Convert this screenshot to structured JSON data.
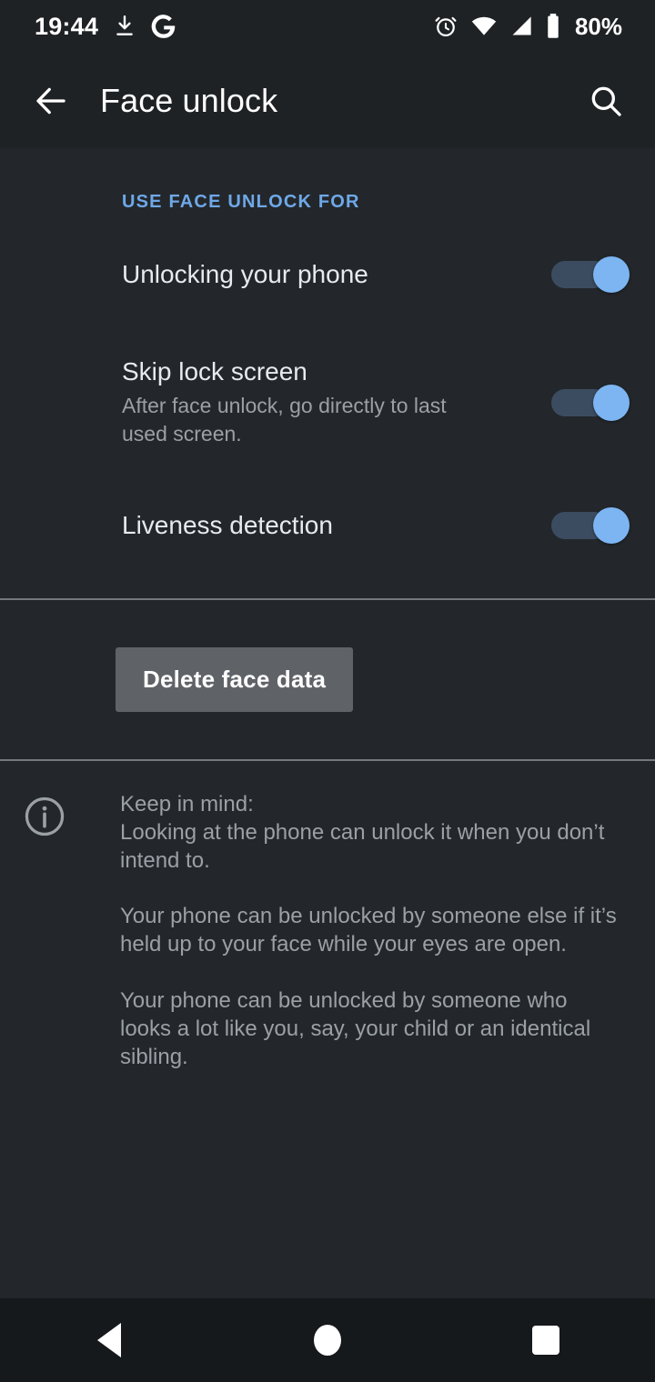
{
  "status_bar": {
    "clock": "19:44",
    "battery_percent": "80%",
    "icons_left": [
      "download-icon",
      "google-g-icon"
    ],
    "icons_right": [
      "alarm-icon",
      "wifi-icon",
      "cellular-signal-icon",
      "battery-icon"
    ]
  },
  "app_bar": {
    "back_icon": "back-arrow-icon",
    "title": "Face unlock",
    "search_icon": "search-icon"
  },
  "content": {
    "section_header": "USE FACE UNLOCK FOR",
    "preferences": [
      {
        "title": "Unlocking your phone",
        "subtitle": "",
        "switch_on": true
      },
      {
        "title": "Skip lock screen",
        "subtitle": "After face unlock, go directly to last used screen.",
        "switch_on": true
      },
      {
        "title": "Liveness detection",
        "subtitle": "",
        "switch_on": true
      }
    ],
    "delete_button": "Delete face data",
    "info": {
      "icon": "info-circle-icon",
      "paragraphs": [
        "Keep in mind:\nLooking at the phone can unlock it when you don’t intend to.",
        "Your phone can be unlocked by someone else if it’s held up to your face while your eyes are open.",
        "Your phone can be unlocked by someone who looks a lot like you, say, your child or an identical sibling."
      ]
    }
  },
  "nav_bar": {
    "back": "back-nav-icon",
    "home": "home-nav-icon",
    "recents": "recents-nav-icon"
  },
  "colors": {
    "accent_blue": "#6fa8e8",
    "switch_thumb": "#7cb5f2",
    "switch_track": "#3c4c60",
    "background": "#23272b",
    "app_bar_bg": "#1f2225",
    "button_bg": "#5f6368"
  }
}
